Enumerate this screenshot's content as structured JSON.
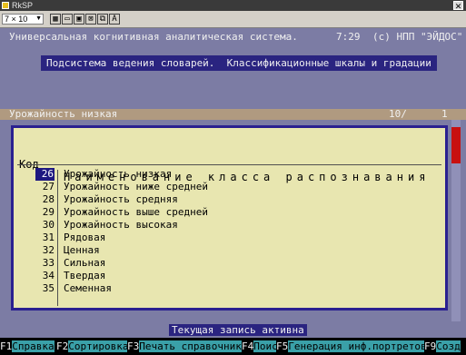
{
  "window": {
    "title": "RkSP",
    "close": "✕"
  },
  "toolbar": {
    "select_value": "7 × 10",
    "buttons": [
      "▦",
      "▭",
      "▣",
      "⊠",
      "⧉",
      "A"
    ]
  },
  "header": {
    "system_title": "Универсальная когнитивная аналитическая система.",
    "time": "7:29",
    "org": "(c) НПП \"ЭЙДОС\""
  },
  "subsystem": "Подсистема ведения словарей.  Классификационные шкалы и градации",
  "record_bar": {
    "current": "Урожайность низкая",
    "count": "10/",
    "total": "1"
  },
  "table": {
    "col_code": "Код",
    "col_name": "Наименование класса распознавания",
    "rows": [
      {
        "code": "26",
        "name": "Урожайность низкая",
        "selected": true
      },
      {
        "code": "27",
        "name": "Урожайность ниже средней"
      },
      {
        "code": "28",
        "name": "Урожайность средняя"
      },
      {
        "code": "29",
        "name": "Урожайность выше средней"
      },
      {
        "code": "30",
        "name": "Урожайность высокая"
      },
      {
        "code": "31",
        "name": "Рядовая"
      },
      {
        "code": "32",
        "name": "Ценная"
      },
      {
        "code": "33",
        "name": "Сильная"
      },
      {
        "code": "34",
        "name": "Твердая"
      },
      {
        "code": "35",
        "name": "Семенная"
      }
    ]
  },
  "status": "Текущая запись активна",
  "fkeys": [
    {
      "key": "F1",
      "label": "Справка"
    },
    {
      "key": "F2",
      "label": "Сортировка"
    },
    {
      "key": "F3",
      "label": "Печать справочника"
    },
    {
      "key": "F4",
      "label": "Поиск"
    },
    {
      "key": "F5",
      "label": "Генерация инф.портретов"
    },
    {
      "key": "F9",
      "label": "Созд"
    }
  ],
  "colors": {
    "screen_bg": "#7c7ca4",
    "panel_bg": "#e8e6b0",
    "panel_border": "#2a2090",
    "selection_bg": "#1e1880",
    "fkey_label_bg": "#3aa0a8",
    "scroll_thumb": "#c81010"
  }
}
